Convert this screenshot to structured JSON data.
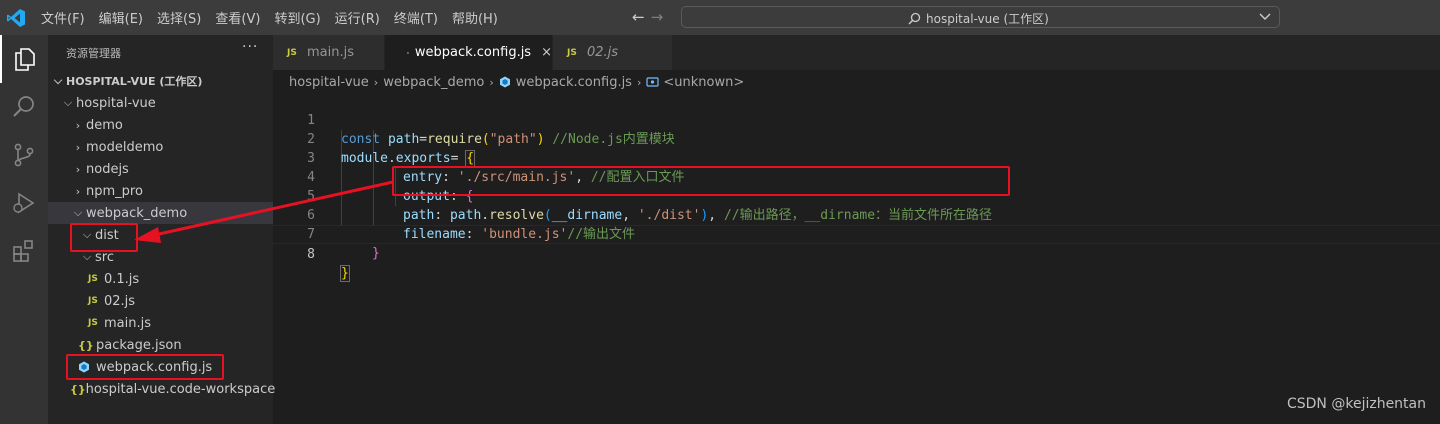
{
  "menu": [
    "文件(F)",
    "编辑(E)",
    "选择(S)",
    "查看(V)",
    "转到(G)",
    "运行(R)",
    "终端(T)",
    "帮助(H)"
  ],
  "search": {
    "text": "hospital-vue (工作区)"
  },
  "sidebar": {
    "title": "资源管理器",
    "more": "···",
    "root": "HOSPITAL-VUE (工作区)",
    "items": [
      {
        "label": "hospital-vue"
      },
      {
        "label": "demo"
      },
      {
        "label": "modeldemo"
      },
      {
        "label": "nodejs"
      },
      {
        "label": "npm_pro"
      },
      {
        "label": "webpack_demo"
      },
      {
        "label": "dist"
      },
      {
        "label": "src"
      },
      {
        "label": "0.1.js"
      },
      {
        "label": "02.js"
      },
      {
        "label": "main.js"
      },
      {
        "label": "package.json"
      },
      {
        "label": "webpack.config.js"
      },
      {
        "label": "hospital-vue.code-workspace"
      }
    ]
  },
  "icons": {
    "js": "JS",
    "json": "{}"
  },
  "tabs": [
    {
      "label": "main.js"
    },
    {
      "label": "webpack.config.js",
      "close": "×"
    },
    {
      "label": "02.js"
    }
  ],
  "breadcrumb": [
    "hospital-vue",
    "webpack_demo",
    "webpack.config.js",
    "<unknown>"
  ],
  "code": {
    "line_numbers": [
      "1",
      "2",
      "3",
      "4",
      "5",
      "6",
      "7",
      "8"
    ],
    "l1": {
      "kw": "const",
      "var": "path",
      "eq": "=",
      "fn": "require",
      "paren_open": "(",
      "str": "\"path\"",
      "paren_close": ")",
      "comment": "//Node.js内置模块"
    },
    "l2": {
      "module": "module",
      "dot": ".",
      "exports": "exports",
      "eq": "= ",
      "brace": "{"
    },
    "l3": {
      "key": "entry",
      "colon": ": ",
      "str": "'./src/main.js'",
      "comma": ", ",
      "comment": "//配置入口文件"
    },
    "l4": {
      "key": "output",
      "colon": ": ",
      "brace": "{"
    },
    "l5": {
      "key": "path",
      "colon": ": ",
      "obj": "path",
      "dot": ".",
      "fn": "resolve",
      "paren_open": "(",
      "arg": "__dirname",
      "comma": ", ",
      "str": "'./dist'",
      "paren_close": ")",
      "comma2": ", ",
      "comment": "//输出路径，__dirname：当前文件所在路径"
    },
    "l6": {
      "key": "filename",
      "colon": ": ",
      "str": "'bundle.js'",
      "comment": "//输出文件"
    },
    "l7": {
      "brace": "}"
    },
    "l8": {
      "brace": "}"
    }
  },
  "watermark": "CSDN @kejizhentan"
}
